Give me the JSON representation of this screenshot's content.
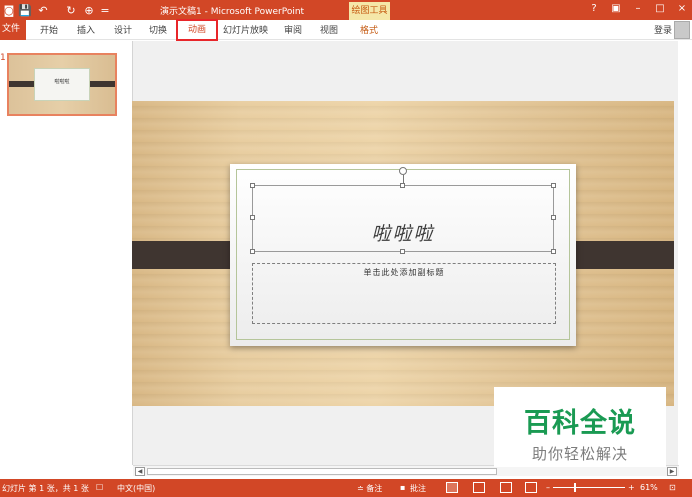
{
  "title_bar": {
    "title": "演示文稿1 - Microsoft PowerPoint",
    "contextual_tab_group": "绘图工具",
    "help": "?",
    "ribbon_display": "▣",
    "minimize": "–",
    "maximize": "□",
    "close": "×",
    "quick_access": {
      "undo": "↶",
      "redo": "↻",
      "customize": "="
    }
  },
  "ribbon": {
    "tabs": [
      "文件",
      "开始",
      "插入",
      "设计",
      "切换",
      "动画",
      "幻灯片放映",
      "审阅",
      "视图",
      "格式"
    ],
    "selected_tab": "动画",
    "login": "登录"
  },
  "thumbnail": {
    "slide_number": "1",
    "title": "啦啦啦"
  },
  "slide": {
    "title": "啦啦啦",
    "subtitle": "单击此处添加副标题"
  },
  "watermark": {
    "main": "百科全说",
    "sub": "助你轻松解决"
  },
  "status_bar": {
    "slide_info": "幻灯片 第 1 张，共 1 张",
    "language": "中文(中国)",
    "notes": "≐ 备注",
    "comments": "批注",
    "zoom_minus": "–",
    "zoom_plus": "+",
    "zoom": "61%",
    "zoom_fraction": 0.61
  },
  "colors": {
    "accent": "#d24726",
    "highlight_box": "#e8262a",
    "watermark_green": "#1a9a53",
    "band": "#3f3530"
  }
}
